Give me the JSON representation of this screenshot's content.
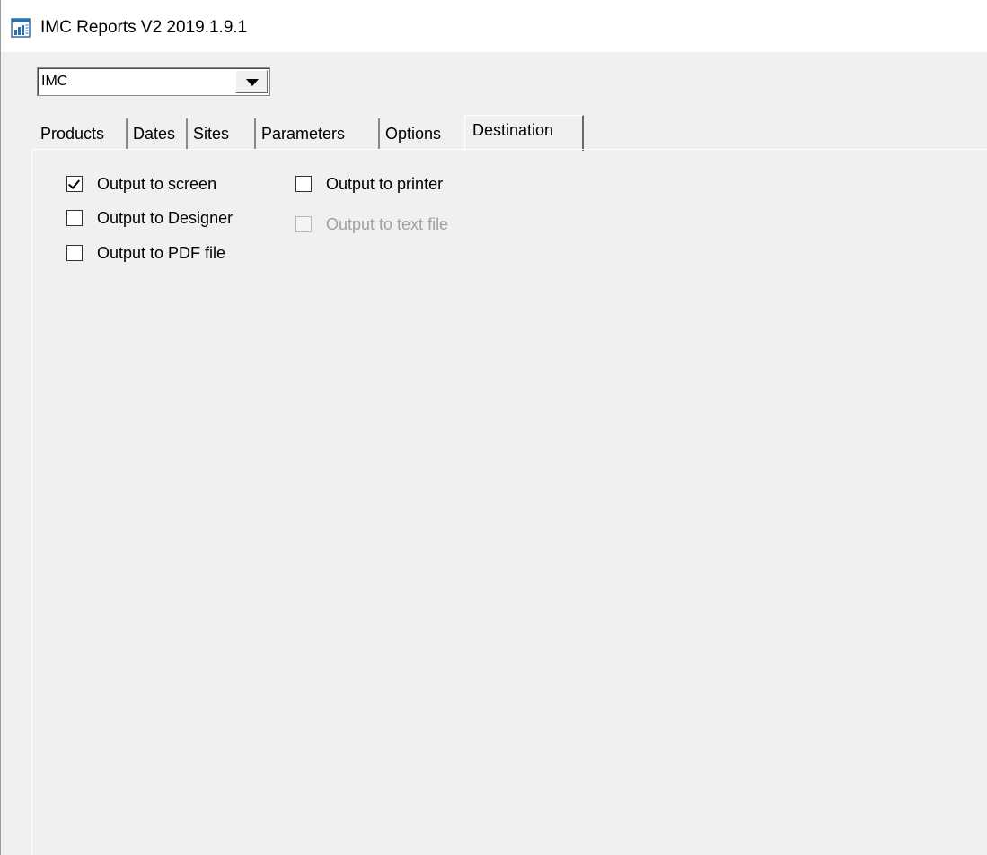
{
  "window": {
    "title": "IMC Reports V2 2019.1.9.1"
  },
  "company_combo": {
    "value": "IMC"
  },
  "tabs": [
    {
      "label": "Products",
      "active": false
    },
    {
      "label": "Dates",
      "active": false
    },
    {
      "label": "Sites",
      "active": false
    },
    {
      "label": "Parameters",
      "active": false
    },
    {
      "label": "Options",
      "active": false
    },
    {
      "label": "Destination",
      "active": true
    }
  ],
  "destination": {
    "output_screen": {
      "label": "Output to screen",
      "checked": true,
      "enabled": true
    },
    "output_designer": {
      "label": "Output to Designer",
      "checked": false,
      "enabled": true
    },
    "output_pdf": {
      "label": "Output to PDF file",
      "checked": false,
      "enabled": true
    },
    "output_printer": {
      "label": "Output to printer",
      "checked": false,
      "enabled": true
    },
    "output_text": {
      "label": "Output to text file",
      "checked": false,
      "enabled": false
    }
  }
}
